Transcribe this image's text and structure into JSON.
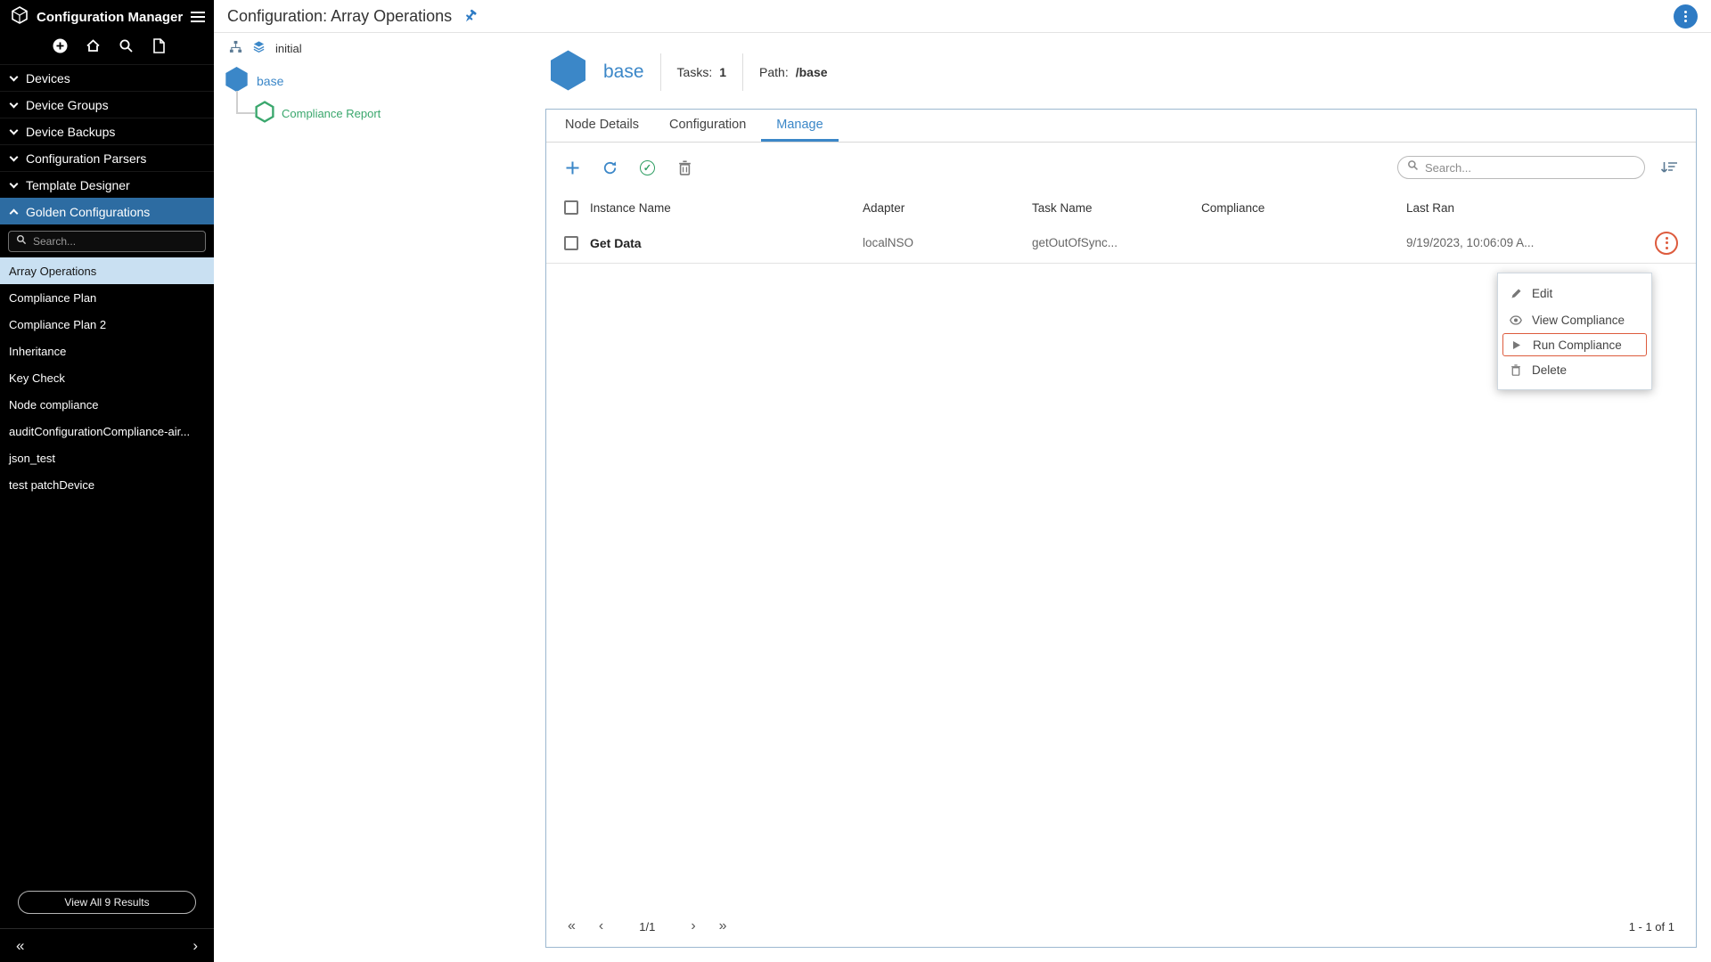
{
  "app": {
    "title": "Configuration Manager"
  },
  "topbar": {
    "title": "Configuration: Array Operations"
  },
  "sidebar": {
    "sections": [
      "Devices",
      "Device Groups",
      "Device Backups",
      "Configuration Parsers",
      "Template Designer",
      "Golden Configurations"
    ],
    "search_placeholder": "Search...",
    "items": [
      "Array Operations",
      "Compliance Plan",
      "Compliance Plan 2",
      "Inheritance",
      "Key Check",
      "Node compliance",
      "auditConfigurationCompliance-air...",
      "json_test",
      "test patchDevice"
    ],
    "view_all_label": "View All 9 Results"
  },
  "tree": {
    "root_label": "initial",
    "base_label": "base",
    "report_label": "Compliance Report"
  },
  "node": {
    "name": "base",
    "tasks_label": "Tasks:",
    "tasks_value": "1",
    "path_label": "Path:",
    "path_value": "/base"
  },
  "tabs": [
    "Node Details",
    "Configuration",
    "Manage"
  ],
  "toolbar": {
    "search_placeholder": "Search..."
  },
  "table": {
    "headers": {
      "instance": "Instance Name",
      "adapter": "Adapter",
      "task": "Task Name",
      "compliance": "Compliance",
      "last_ran": "Last Ran"
    },
    "row": {
      "instance": "Get Data",
      "adapter": "localNSO",
      "task": "getOutOfSync...",
      "last_ran": "9/19/2023, 10:06:09 A..."
    }
  },
  "menu": {
    "edit": "Edit",
    "view": "View Compliance",
    "run": "Run Compliance",
    "delete": "Delete"
  },
  "pagination": {
    "first": "«",
    "prev": "‹",
    "page": "1/1",
    "next": "›",
    "last": "»",
    "range": "1 - 1 of 1"
  },
  "footer": {
    "collapse": "«",
    "expand": "›"
  },
  "colors": {
    "accent_blue": "#3b87c8",
    "sidebar_active_blue": "#2d6ca2",
    "compliance_orange": "#f0a43f",
    "alert_orange_red": "#dd5b3d",
    "compliance_green": "#3aa76d"
  }
}
